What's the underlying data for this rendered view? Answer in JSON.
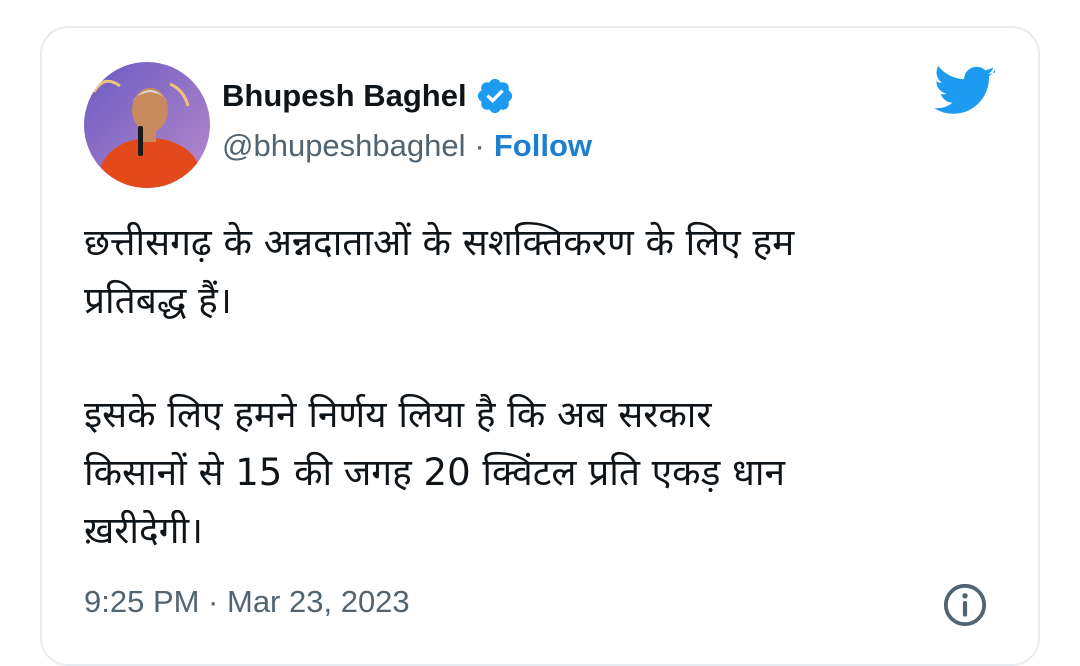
{
  "tweet": {
    "author_name": "Bhupesh Baghel",
    "handle": "@bhupeshbaghel",
    "separator": "·",
    "follow_label": "Follow",
    "text_lines": [
      "छत्तीसगढ़ के अन्नदाताओं के सशक्तिकरण के लिए हम",
      "प्रतिबद्ध हैं।",
      "इसके लिए हमने निर्णय लिया है कि अब सरकार",
      "किसानों से 15 की जगह 20 क्विंटल प्रति एकड़ धान",
      "ख़रीदेगी।"
    ],
    "timestamp": "9:25 PM · Mar 23, 2023"
  },
  "icons": {
    "verified": "verified-badge-icon",
    "logo": "twitter-bird-icon",
    "info": "info-icon"
  },
  "colors": {
    "accent": "#1d9bf0",
    "follow": "#1d7fd0",
    "text": "#0f1419",
    "muted": "#536471",
    "border": "#e6ecf0"
  }
}
